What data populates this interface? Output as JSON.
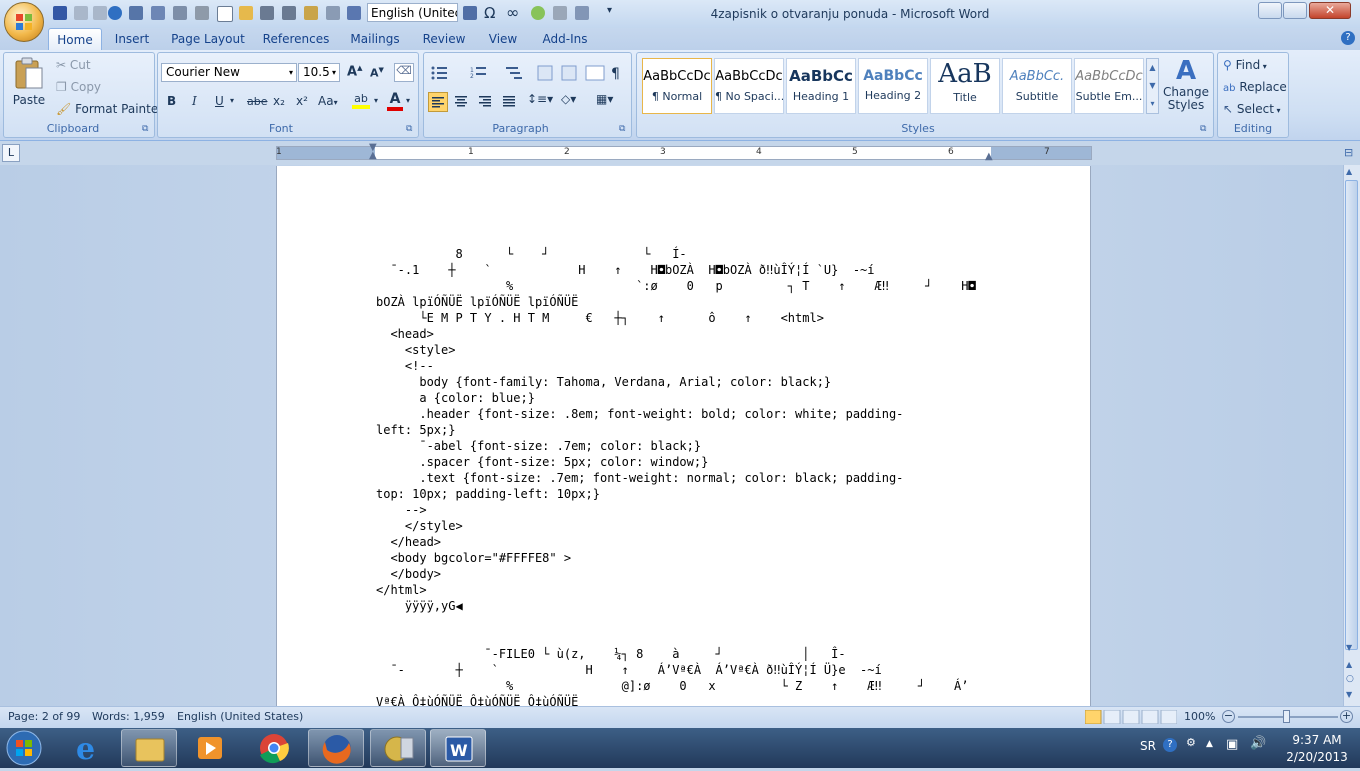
{
  "window": {
    "title": "4zapisnik o otvaranju ponuda - Microsoft Word",
    "language_box": "English (Unitec"
  },
  "tabs": [
    "Home",
    "Insert",
    "Page Layout",
    "References",
    "Mailings",
    "Review",
    "View",
    "Add-Ins"
  ],
  "clipboard": {
    "paste": "Paste",
    "cut": "Cut",
    "copy": "Copy",
    "format_painter": "Format Painter",
    "label": "Clipboard"
  },
  "font": {
    "name": "Courier New",
    "size": "10.5",
    "bold": "B",
    "italic": "I",
    "underline": "U",
    "strike": "abe",
    "subscript": "x₂",
    "superscript": "x²",
    "change_case": "Aa",
    "grow": "A",
    "shrink": "A",
    "label": "Font"
  },
  "paragraph": {
    "label": "Paragraph"
  },
  "styles": {
    "items": [
      {
        "sample": "AaBbCcDc",
        "name": "¶ Normal"
      },
      {
        "sample": "AaBbCcDc",
        "name": "¶ No Spaci..."
      },
      {
        "sample": "AaBbCc",
        "name": "Heading 1"
      },
      {
        "sample": "AaBbCc",
        "name": "Heading 2"
      },
      {
        "sample": "AaB",
        "name": "Title"
      },
      {
        "sample": "AaBbCc.",
        "name": "Subtitle"
      },
      {
        "sample": "AaBbCcDc",
        "name": "Subtle Em..."
      }
    ],
    "change_styles": "Change Styles",
    "label": "Styles"
  },
  "editing": {
    "find": "Find",
    "replace": "Replace",
    "select": "Select",
    "label": "Editing"
  },
  "ruler": {
    "numbers": [
      "1",
      "1",
      "2",
      "3",
      "4",
      "5",
      "6",
      "7"
    ],
    "tab_selector": "L"
  },
  "document": {
    "lines": [
      "           8      └    ┘             └   Í-",
      "  ¯-.1    ┼    `            H    ↑    H◘bOZÀ  H◘bOZÀ ð‼ùÎÝ¦Í `U}  -~í",
      "                  %                 `:ø    0   p         ┐ T    ↑    Æ‼     ┘    H◘",
      "bOZÀ lpïÓÑÜË lpïÓÑÜË lpïÓÑÜË",
      "      └E M P T Y . H T M     €   ┼┐    ↑      ô    ↑    <html>",
      "  <head>",
      "    <style>",
      "    <!--",
      "      body {font-family: Tahoma, Verdana, Arial; color: black;}",
      "      a {color: blue;}",
      "      .header {font-size: .8em; font-weight: bold; color: white; padding-",
      "left: 5px;}",
      "      ¯-abel {font-size: .7em; color: black;}",
      "      .spacer {font-size: 5px; color: window;}",
      "      .text {font-size: .7em; font-weight: normal; color: black; padding-",
      "top: 10px; padding-left: 10px;}",
      "    -->",
      "    </style>",
      "  </head>",
      "  <body bgcolor=\"#FFFFE8\" >",
      "  </body>",
      "</html>",
      "    ÿÿÿÿ,yG◀",
      "",
      "",
      "               ¯-FILE0 └ ù(z,    ¼┐ 8    à     ┘           │   Î-",
      "  ¯-       ┼    `            H    ↑    Á’Vª€À  Á’Vª€À ð‼ùÎÝ¦Í Ü}e  -~í",
      "                  %               @]:ø    0   x         └ Z    ↑    Æ‼     ┘    Á’",
      "Vª€À Ô‡ùÓÑÜË Ô‡ùÓÑÜË Ô‡ùÓÑÜË"
    ]
  },
  "status": {
    "page": "Page: 2 of 99",
    "words": "Words: 1,959",
    "language": "English (United States)",
    "zoom": "100%"
  },
  "tray": {
    "lang": "SR",
    "time": "9:37 AM",
    "date": "2/20/2013"
  },
  "colors": {
    "ribbon_text": "#15428b",
    "taskbar": "#2b4668",
    "page": "#ffffff"
  }
}
